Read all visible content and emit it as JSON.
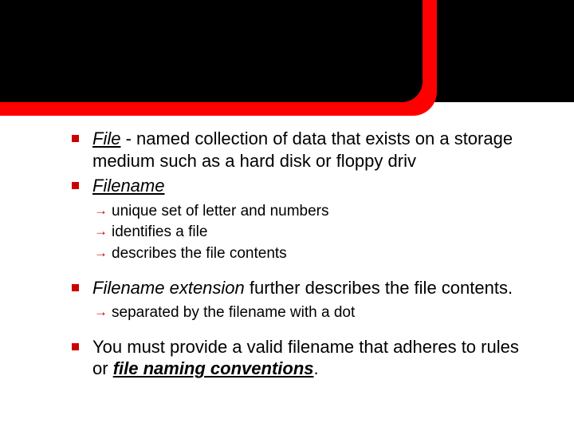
{
  "items": [
    {
      "type": "main",
      "html": "<span class='term'>File</span> - named collection of data that exists on a storage medium such as a hard disk or floppy driv"
    },
    {
      "type": "main",
      "html": "<span class='term'>Filename</span>"
    },
    {
      "type": "sub",
      "text": "unique set of letter and numbers"
    },
    {
      "type": "sub",
      "text": "identifies a file"
    },
    {
      "type": "sub",
      "text": "describes the file contents"
    },
    {
      "type": "main",
      "html": "<span class='ital'>Filename extension</span> further describes the file contents."
    },
    {
      "type": "sub",
      "text": "separated by the filename with a dot"
    },
    {
      "type": "main",
      "html": "You must provide a valid filename that adheres to rules or <span class='bolditalunder'>file naming conventions</span>."
    }
  ]
}
